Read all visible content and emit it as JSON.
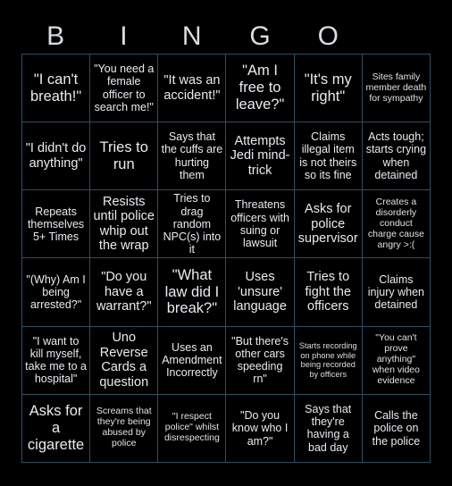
{
  "header": {
    "letters": [
      "B",
      "I",
      "N",
      "G",
      "O",
      ""
    ]
  },
  "grid": {
    "columns": 6,
    "rows": 6,
    "border_color": "#2d4f60",
    "background_color": "#000000",
    "text_color": "#e8ecef",
    "cells": [
      {
        "text": "\"I can't breath!\"",
        "size": "xl"
      },
      {
        "text": "\"You need a female officer to search me!\"",
        "size": "md"
      },
      {
        "text": "\"It was an accident!\"",
        "size": "lg"
      },
      {
        "text": "\"Am I free to leave?\"",
        "size": "xl"
      },
      {
        "text": "\"It's my right\"",
        "size": "xl"
      },
      {
        "text": "Sites family member death for sympathy",
        "size": "sm"
      },
      {
        "text": "\"I didn't do anything\"",
        "size": "lg"
      },
      {
        "text": "Tries to run",
        "size": "xl"
      },
      {
        "text": "Says that the cuffs are hurting them",
        "size": "md"
      },
      {
        "text": "Attempts Jedi mind-trick",
        "size": "lg"
      },
      {
        "text": "Claims illegal item is not theirs so its fine",
        "size": "md"
      },
      {
        "text": "Acts tough; starts crying when detained",
        "size": "md"
      },
      {
        "text": "Repeats themselves 5+ Times",
        "size": "md"
      },
      {
        "text": "Resists until police whip out the wrap",
        "size": "lg"
      },
      {
        "text": "Tries to drag random NPC(s) into it",
        "size": "md"
      },
      {
        "text": "Threatens officers with suing or lawsuit",
        "size": "md"
      },
      {
        "text": "Asks for police supervisor",
        "size": "lg"
      },
      {
        "text": "Creates a disorderly conduct charge cause angry >:(",
        "size": "sm"
      },
      {
        "text": "\"(Why) Am I being arrested?\"",
        "size": "md"
      },
      {
        "text": "\"Do you have a warrant?\"",
        "size": "lg"
      },
      {
        "text": "\"What law did I break?\"",
        "size": "xl"
      },
      {
        "text": "Uses 'unsure' language",
        "size": "lg"
      },
      {
        "text": "Tries to fight the officers",
        "size": "lg"
      },
      {
        "text": "Claims injury when detained",
        "size": "md"
      },
      {
        "text": "\"I want to kill myself, take me to a hospital\"",
        "size": "md"
      },
      {
        "text": "Uno Reverse Cards a question",
        "size": "lg"
      },
      {
        "text": "Uses an Amendment Incorrectly",
        "size": "md"
      },
      {
        "text": "\"But there's other cars speeding rn\"",
        "size": "md"
      },
      {
        "text": "Starts recording on phone while being recorded by officers",
        "size": "xs"
      },
      {
        "text": "\"You can't prove anything\" when video evidence",
        "size": "sm"
      },
      {
        "text": "Asks for a cigarette",
        "size": "xl"
      },
      {
        "text": "Screams that they're being abused by police",
        "size": "sm"
      },
      {
        "text": "\"I respect police\" whilst disrespecting",
        "size": "sm"
      },
      {
        "text": "\"Do you know who I am?\"",
        "size": "md"
      },
      {
        "text": "Says that they're having a bad day",
        "size": "md"
      },
      {
        "text": "Calls the police on the police",
        "size": "md"
      }
    ]
  }
}
